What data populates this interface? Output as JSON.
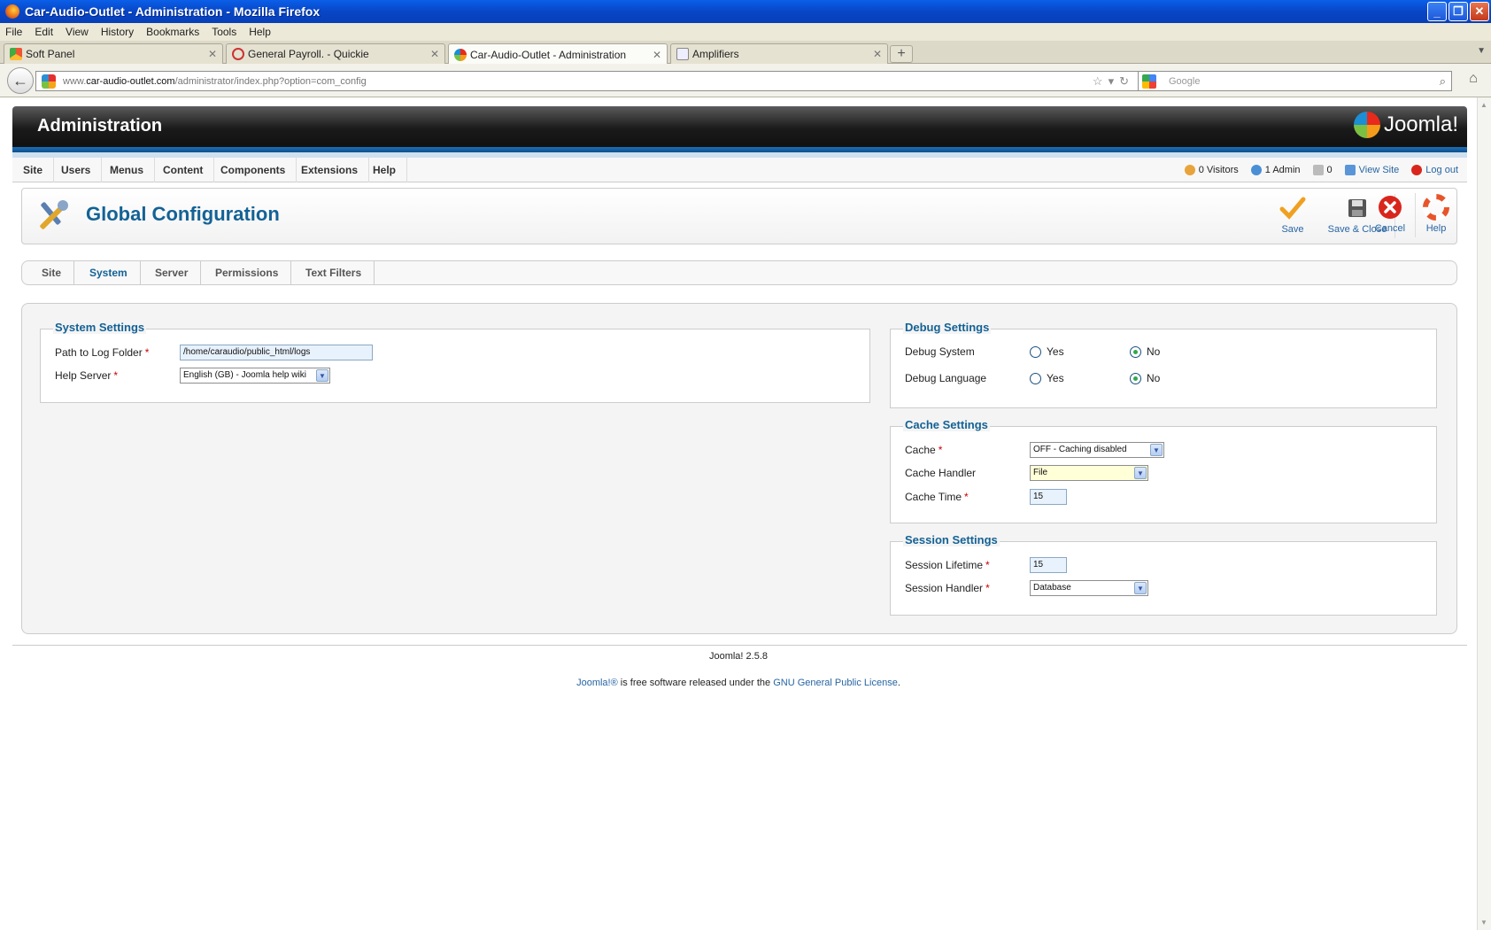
{
  "window": {
    "title": "Car-Audio-Outlet - Administration - Mozilla Firefox"
  },
  "menubar": [
    "File",
    "Edit",
    "View",
    "History",
    "Bookmarks",
    "Tools",
    "Help"
  ],
  "tabs": [
    {
      "label": "Soft Panel"
    },
    {
      "label": "General Payroll. - Quickie"
    },
    {
      "label": "Car-Audio-Outlet - Administration"
    },
    {
      "label": "Amplifiers"
    }
  ],
  "url": {
    "prefix": "www.",
    "domain": "car-audio-outlet.com",
    "path": "/administrator/index.php?option=com_config"
  },
  "search": {
    "placeholder": "Google"
  },
  "header": {
    "title": "Administration",
    "logo": "Joomla!"
  },
  "mainmenu": [
    "Site",
    "Users",
    "Menus",
    "Content",
    "Components",
    "Extensions",
    "Help"
  ],
  "status": {
    "visitors": "0 Visitors",
    "admin": "1 Admin",
    "messages": "0",
    "view_site": "View Site",
    "logout": "Log out"
  },
  "page": {
    "title": "Global Configuration"
  },
  "toolbar": {
    "save": "Save",
    "save_close": "Save & Close",
    "cancel": "Cancel",
    "help": "Help"
  },
  "subtabs": [
    "Site",
    "System",
    "Server",
    "Permissions",
    "Text Filters"
  ],
  "system_settings": {
    "legend": "System Settings",
    "log_label": "Path to Log Folder",
    "log_value": "/home/caraudio/public_html/logs",
    "help_label": "Help Server",
    "help_value": "English (GB) - Joomla help wiki"
  },
  "debug_settings": {
    "legend": "Debug Settings",
    "system_label": "Debug System",
    "language_label": "Debug Language",
    "yes": "Yes",
    "no": "No"
  },
  "cache_settings": {
    "legend": "Cache Settings",
    "cache_label": "Cache",
    "cache_value": "OFF - Caching disabled",
    "handler_label": "Cache Handler",
    "handler_value": "File",
    "time_label": "Cache Time",
    "time_value": "15"
  },
  "session_settings": {
    "legend": "Session Settings",
    "lifetime_label": "Session Lifetime",
    "lifetime_value": "15",
    "handler_label": "Session Handler",
    "handler_value": "Database"
  },
  "footer": {
    "version": "Joomla! 2.5.8",
    "link1": "Joomla!®",
    "mid": " is free software released under the ",
    "link2": "GNU General Public License",
    "end": "."
  }
}
